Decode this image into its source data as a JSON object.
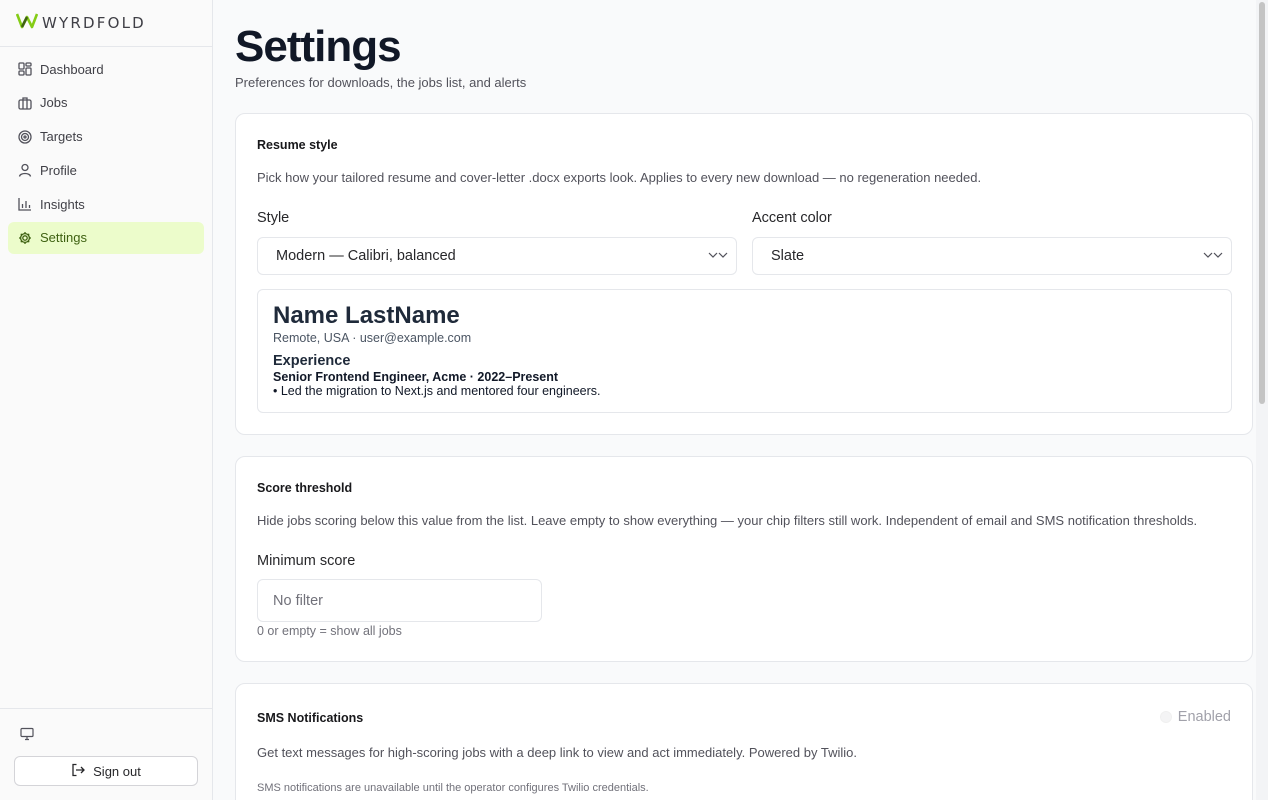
{
  "brand": {
    "name": "WYRDFOLD",
    "accent": "#84cc16"
  },
  "sidebar": {
    "items": [
      {
        "label": "Dashboard",
        "icon": "dashboard-icon"
      },
      {
        "label": "Jobs",
        "icon": "briefcase-icon"
      },
      {
        "label": "Targets",
        "icon": "target-icon"
      },
      {
        "label": "Profile",
        "icon": "user-icon"
      },
      {
        "label": "Insights",
        "icon": "bar-chart-icon"
      },
      {
        "label": "Settings",
        "icon": "gear-icon",
        "active": true
      }
    ],
    "theme_icon": "monitor-icon",
    "signout_label": "Sign out"
  },
  "page": {
    "title": "Settings",
    "subtitle": "Preferences for downloads, the jobs list, and alerts"
  },
  "resume_style": {
    "title": "Resume style",
    "description": "Pick how your tailored resume and cover-letter .docx exports look. Applies to every new download — no regeneration needed.",
    "style_label": "Style",
    "style_value": "Modern — Calibri, balanced",
    "accent_label": "Accent color",
    "accent_value": "Slate",
    "preview": {
      "name": "Name LastName",
      "contact": "Remote, USA · user@example.com",
      "section": "Experience",
      "role": "Senior Frontend Engineer, Acme · 2022–Present",
      "bullet": "• Led the migration to Next.js and mentored four engineers."
    }
  },
  "score_threshold": {
    "title": "Score threshold",
    "description": "Hide jobs scoring below this value from the list. Leave empty to show everything — your chip filters still work. Independent of email and SMS notification thresholds.",
    "field_label": "Minimum score",
    "placeholder": "No filter",
    "hint": "0 or empty = show all jobs"
  },
  "sms": {
    "title": "SMS Notifications",
    "toggle_label": "Enabled",
    "description": "Get text messages for high-scoring jobs with a deep link to view and act immediately. Powered by Twilio.",
    "note": "SMS notifications are unavailable until the operator configures Twilio credentials."
  }
}
